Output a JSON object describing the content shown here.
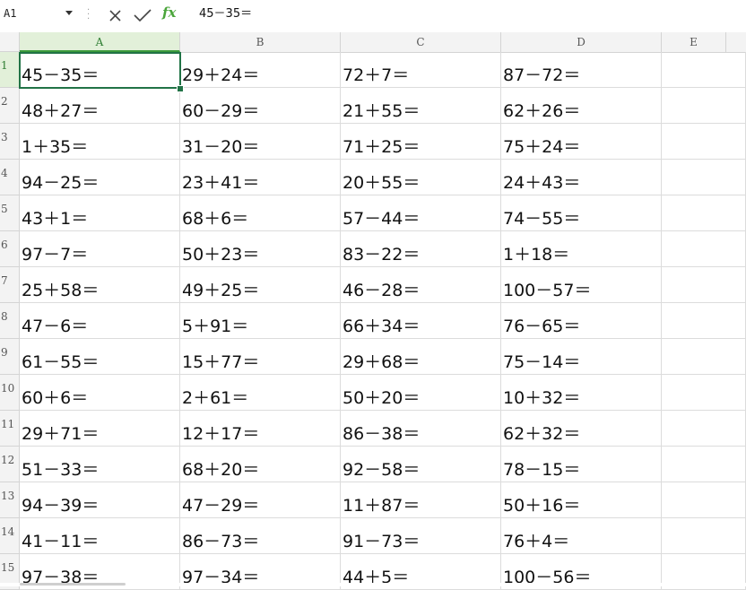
{
  "name_box": {
    "value": "A1"
  },
  "formula_bar": {
    "fx_label": "fx",
    "content": "45－35＝"
  },
  "columns": [
    "A",
    "B",
    "C",
    "D",
    "E"
  ],
  "selected_cell": "A1",
  "rows": [
    {
      "num": "1",
      "cells": [
        "45－35＝",
        "29＋24＝",
        "72＋7＝",
        "87－72＝",
        ""
      ]
    },
    {
      "num": "2",
      "cells": [
        "48＋27＝",
        "60－29＝",
        "21＋55＝",
        "62＋26＝",
        ""
      ]
    },
    {
      "num": "3",
      "cells": [
        "1＋35＝",
        "31－20＝",
        "71＋25＝",
        "75＋24＝",
        ""
      ]
    },
    {
      "num": "4",
      "cells": [
        "94－25＝",
        "23＋41＝",
        "20＋55＝",
        "24＋43＝",
        ""
      ]
    },
    {
      "num": "5",
      "cells": [
        "43＋1＝",
        "68＋6＝",
        "57－44＝",
        "74－55＝",
        ""
      ]
    },
    {
      "num": "6",
      "cells": [
        "97－7＝",
        "50＋23＝",
        "83－22＝",
        "1＋18＝",
        ""
      ]
    },
    {
      "num": "7",
      "cells": [
        "25＋58＝",
        "49＋25＝",
        "46－28＝",
        "100－57＝",
        ""
      ]
    },
    {
      "num": "8",
      "cells": [
        "47－6＝",
        "5＋91＝",
        "66＋34＝",
        "76－65＝",
        ""
      ]
    },
    {
      "num": "9",
      "cells": [
        "61－55＝",
        "15＋77＝",
        "29＋68＝",
        "75－14＝",
        ""
      ]
    },
    {
      "num": "10",
      "cells": [
        "60＋6＝",
        "2＋61＝",
        "50＋20＝",
        "10＋32＝",
        ""
      ]
    },
    {
      "num": "11",
      "cells": [
        "29＋71＝",
        "12＋17＝",
        "86－38＝",
        "62＋32＝",
        ""
      ]
    },
    {
      "num": "12",
      "cells": [
        "51－33＝",
        "68＋20＝",
        "92－58＝",
        "78－15＝",
        ""
      ]
    },
    {
      "num": "13",
      "cells": [
        "94－39＝",
        "47－29＝",
        "11＋87＝",
        "50＋16＝",
        ""
      ]
    },
    {
      "num": "14",
      "cells": [
        "41－11＝",
        "86－73＝",
        "91－73＝",
        "76＋4＝",
        ""
      ]
    },
    {
      "num": "15",
      "cells": [
        "97－38＝",
        "97－34＝",
        "44＋5＝",
        "100－56＝",
        ""
      ]
    }
  ],
  "icons": {
    "cancel": "close-icon",
    "confirm": "check-icon",
    "function": "fx-icon",
    "name_box_dropdown": "chevron-down-icon"
  },
  "colors": {
    "accent_green": "#217346",
    "fx_green": "#4aa53a",
    "selected_header_bg": "#e2f0d9",
    "grid_line": "#dcdcdc",
    "header_bg": "#f3f3f3"
  }
}
